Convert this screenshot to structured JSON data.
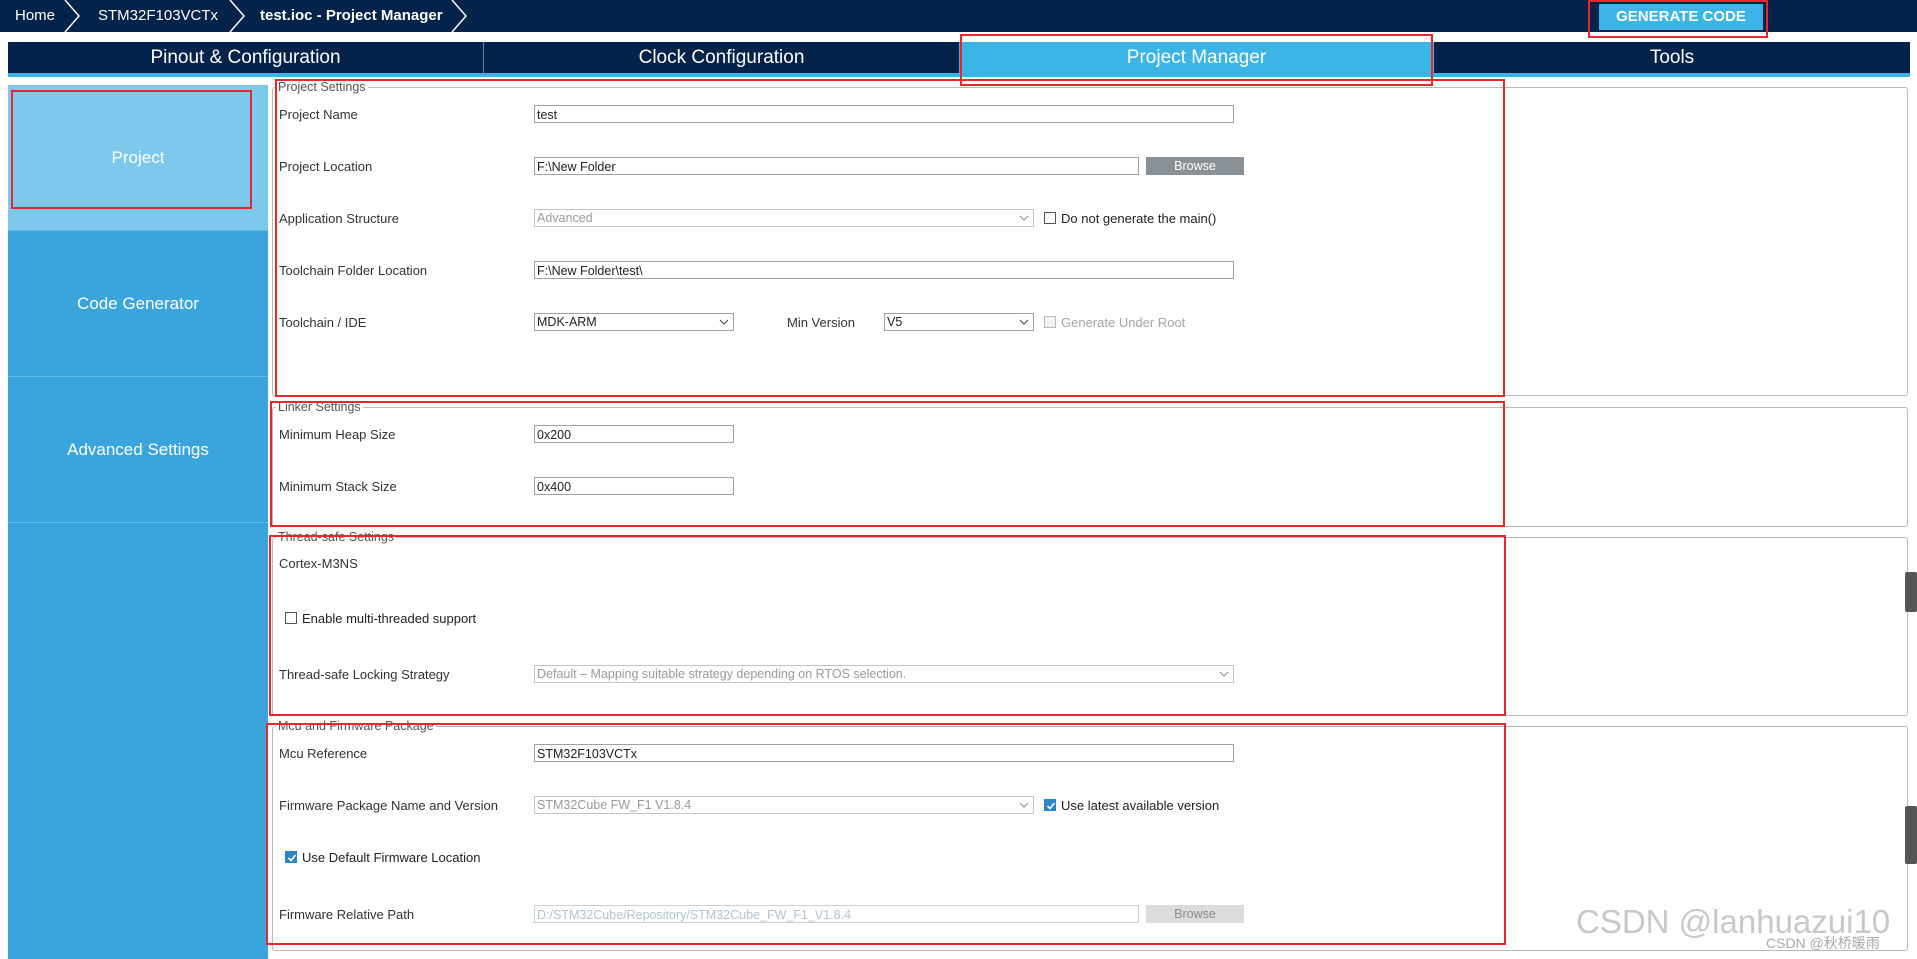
{
  "breadcrumb": {
    "home": "Home",
    "device": "STM32F103VCTx",
    "current": "test.ioc - Project Manager"
  },
  "actions": {
    "generate_code": "GENERATE CODE"
  },
  "tabs": [
    {
      "label": "Pinout & Configuration",
      "active": false
    },
    {
      "label": "Clock Configuration",
      "active": false
    },
    {
      "label": "Project Manager",
      "active": true
    },
    {
      "label": "Tools",
      "active": false
    }
  ],
  "sidebar": {
    "items": [
      {
        "label": "Project",
        "active": true
      },
      {
        "label": "Code Generator",
        "active": false
      },
      {
        "label": "Advanced Settings",
        "active": false
      }
    ]
  },
  "project_settings": {
    "legend": "Project Settings",
    "project_name_label": "Project Name",
    "project_name_value": "test",
    "project_location_label": "Project Location",
    "project_location_value": "F:\\New Folder",
    "browse_label": "Browse",
    "app_structure_label": "Application Structure",
    "app_structure_value": "Advanced",
    "no_main_label": "Do not generate the main()",
    "no_main_checked": false,
    "toolchain_folder_label": "Toolchain Folder Location",
    "toolchain_folder_value": "F:\\New Folder\\test\\",
    "toolchain_ide_label": "Toolchain / IDE",
    "toolchain_ide_value": "MDK-ARM",
    "min_version_label": "Min Version",
    "min_version_value": "V5",
    "gen_under_root_label": "Generate Under Root",
    "gen_under_root_checked": false
  },
  "linker_settings": {
    "legend": "Linker Settings",
    "heap_label": "Minimum Heap Size",
    "heap_value": "0x200",
    "stack_label": "Minimum Stack Size",
    "stack_value": "0x400"
  },
  "thread_safe": {
    "legend": "Thread-safe Settings",
    "core": "Cortex-M3NS",
    "multithread_label": "Enable multi-threaded support",
    "multithread_checked": false,
    "locking_label": "Thread-safe Locking Strategy",
    "locking_value": "Default  –  Mapping suitable strategy depending on RTOS selection."
  },
  "mcu_fw": {
    "legend": "Mcu and Firmware Package",
    "mcu_ref_label": "Mcu Reference",
    "mcu_ref_value": "STM32F103VCTx",
    "fw_pkg_label": "Firmware Package Name and Version",
    "fw_pkg_value": "STM32Cube FW_F1 V1.8.4",
    "use_latest_label": "Use latest available version",
    "use_latest_checked": true,
    "use_default_fw_label": "Use Default Firmware Location",
    "use_default_fw_checked": true,
    "fw_path_label": "Firmware Relative Path",
    "fw_path_value": "D:/STM32Cube/Repository/STM32Cube_FW_F1_V1.8.4",
    "browse_label": "Browse"
  },
  "watermark": {
    "main": "CSDN @lanhuazui10",
    "small": "CSDN @秋桥暖雨"
  },
  "colors": {
    "navy": "#03234b",
    "accent": "#3cb4e6",
    "sidebar": "#3aa5dc",
    "sidebar_active": "#7ec8ec",
    "annotation": "#e8262c"
  }
}
